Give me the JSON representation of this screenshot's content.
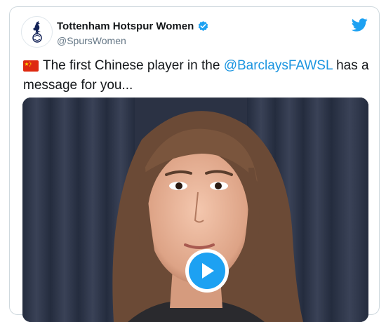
{
  "tweet": {
    "author_name": "Tottenham Hotspur Women",
    "handle": "@SpursWomen",
    "text_before": "The first Chinese player in the ",
    "mention": "@BarclaysFAWSL",
    "text_after": " has a message for you...",
    "flag_icon": "china-flag-icon"
  },
  "icons": {
    "verified": "verified-badge-icon",
    "twitter": "twitter-bird-icon",
    "play": "play-icon",
    "avatar": "spurs-cockerel-icon"
  },
  "colors": {
    "accent": "#1da1f2",
    "mention": "#1b95e0",
    "text": "#14171a",
    "secondary": "#657786",
    "border": "#cfd9de"
  }
}
